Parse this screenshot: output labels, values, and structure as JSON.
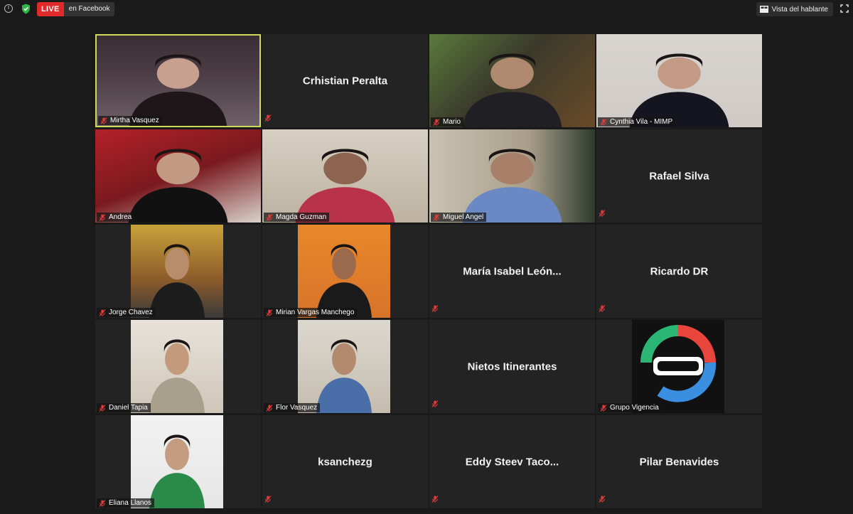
{
  "topbar": {
    "live_label": "LIVE",
    "live_destination": "en Facebook",
    "view_button": "Vista del hablante",
    "icons": [
      "info-icon",
      "shield-check-icon",
      "grid-view-icon",
      "fullscreen-icon"
    ]
  },
  "accent_colors": {
    "live_red": "#e02a2a",
    "active_speaker_border": "#cfd95a",
    "muted_red": "#e23b3b"
  },
  "participants": [
    {
      "name": "Mirtha Vasquez",
      "video": true,
      "active": true
    },
    {
      "name": "Crhistian Peralta",
      "video": false
    },
    {
      "name": "Mario",
      "video": true
    },
    {
      "name": "Cynthia Vila - MIMP",
      "video": true
    },
    {
      "name": "Andrea",
      "video": true
    },
    {
      "name": "Magda Guzman",
      "video": true
    },
    {
      "name": "Miguel Angel",
      "video": true
    },
    {
      "name": "Rafael Silva",
      "video": false
    },
    {
      "name": "Jorge Chavez",
      "video": true
    },
    {
      "name": "Mirian Vargas Manchego",
      "video": true
    },
    {
      "name": "María Isabel León...",
      "video": false
    },
    {
      "name": "Ricardo DR",
      "video": false
    },
    {
      "name": "Daniel Tapia",
      "video": true
    },
    {
      "name": "Flor Vasquez",
      "video": true
    },
    {
      "name": "Nietos Itinerantes",
      "video": false
    },
    {
      "name": "Grupo Vigencia",
      "video": true
    },
    {
      "name": "Eliana Llanos",
      "video": true
    },
    {
      "name": "ksanchezg",
      "video": false
    },
    {
      "name": "Eddy Steev Taco...",
      "video": false
    },
    {
      "name": "Pilar Benavides",
      "video": false
    }
  ]
}
